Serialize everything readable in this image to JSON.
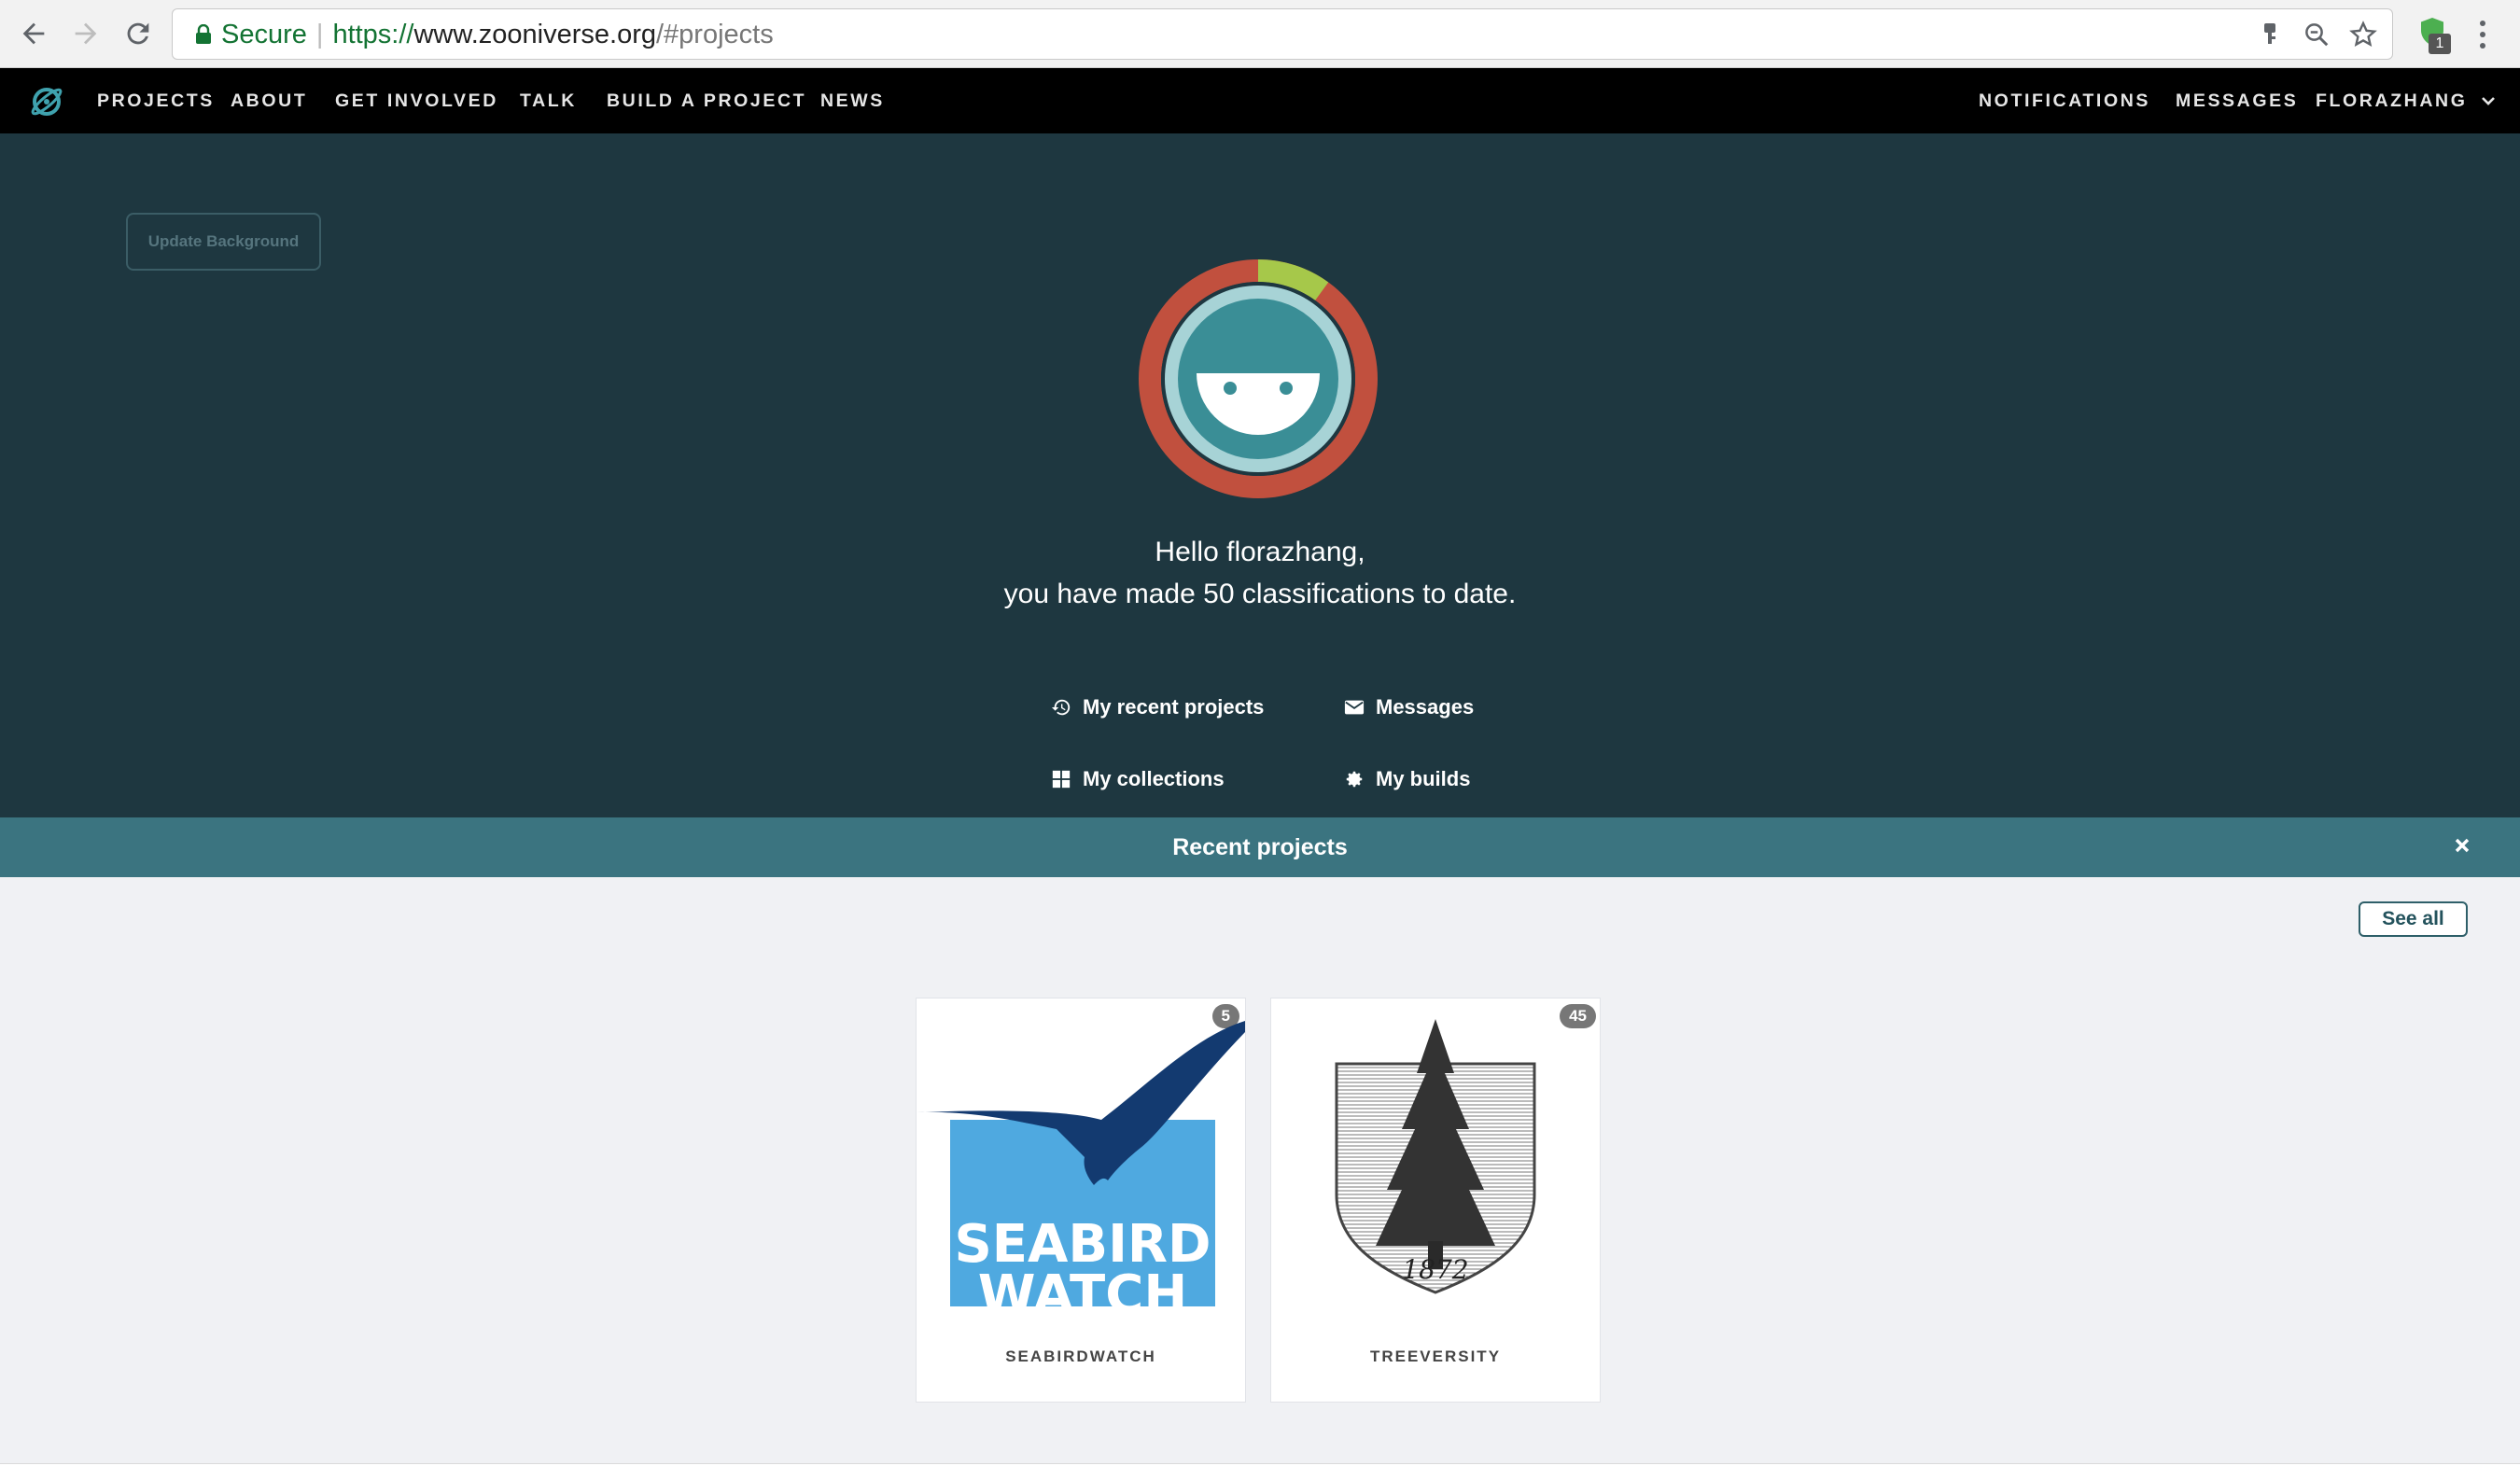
{
  "browser": {
    "secure_label": "Secure",
    "url_scheme": "https://",
    "url_host": "www.zooniverse.org",
    "url_path": "/#projects",
    "extension_badge": "1"
  },
  "nav": {
    "items": [
      "PROJECTS",
      "ABOUT",
      "GET INVOLVED",
      "TALK",
      "BUILD A PROJECT",
      "NEWS"
    ],
    "notifications": "NOTIFICATIONS",
    "messages": "MESSAGES",
    "user": "FLORAZHANG"
  },
  "hero": {
    "update_background": "Update Background",
    "greeting": "Hello florazhang,",
    "classifications_line": "you have made 50 classifications to date.",
    "links": {
      "recent_projects": "My recent projects",
      "messages": "Messages",
      "collections": "My collections",
      "builds": "My builds"
    },
    "ring_progress": 0.1
  },
  "recent": {
    "title": "Recent projects",
    "see_all": "See all",
    "projects": [
      {
        "name": "SEABIRDWATCH",
        "count": "5",
        "logo_text_1": "SEABIRD",
        "logo_text_2": "WATCH"
      },
      {
        "name": "TREEVERSITY",
        "count": "45",
        "logo_text": "1872"
      }
    ]
  },
  "colors": {
    "hero_bg": "#1e3740",
    "recent_bar": "#3b7480",
    "ring_red": "#c1503e",
    "ring_green": "#a6c84a",
    "avatar_teal": "#3a8e96"
  }
}
